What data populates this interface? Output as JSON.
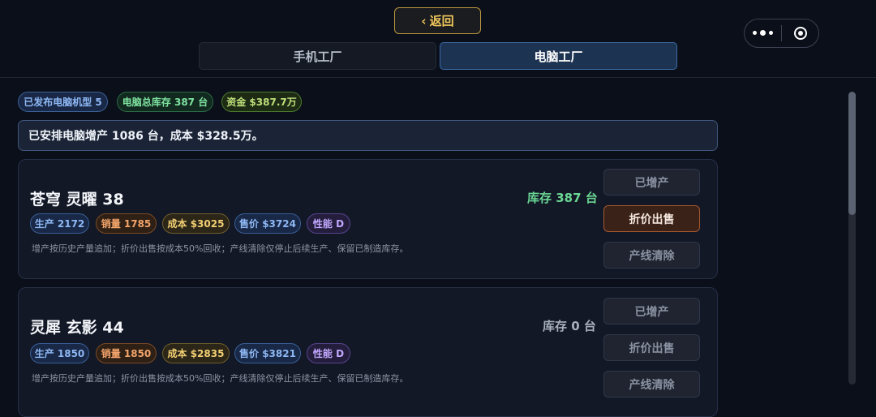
{
  "nav": {
    "back_label": "返回",
    "back_chevron": "‹",
    "capsule": {
      "more_icon": "more-dots-icon",
      "close_icon": "target-close-icon"
    }
  },
  "tabs": [
    {
      "label": "手机工厂",
      "active": false
    },
    {
      "label": "电脑工厂",
      "active": true
    }
  ],
  "summary": {
    "models": "已发布电脑机型 5",
    "inventory": "电脑总库存 387 台",
    "funds": "资金 $387.7万"
  },
  "notice": "已安排电脑增产 1086 台，成本 $328.5万。",
  "products": [
    {
      "name": "苍穹 灵曜 38",
      "stock": "库存 387 台",
      "tags": {
        "production": "生产 2172",
        "sales": "销量 1785",
        "cost": "成本 $3025",
        "price": "售价 $3724",
        "performance": "性能 D"
      },
      "note": "增产按历史产量追加；折价出售按成本50%回收；产线清除仅停止后续生产、保留已制造库存。",
      "actions": {
        "increase": "已增产",
        "discount": "折价出售",
        "clear": "产线清除"
      }
    },
    {
      "name": "灵犀 玄影 44",
      "stock": "库存 0 台",
      "tags": {
        "production": "生产 1850",
        "sales": "销量 1850",
        "cost": "成本 $2835",
        "price": "售价 $3821",
        "performance": "性能 D"
      },
      "note": "增产按历史产量追加；折价出售按成本50%回收；产线清除仅停止后续生产、保留已制造库存。",
      "actions": {
        "increase": "已增产",
        "discount": "折价出售",
        "clear": "产线清除"
      }
    }
  ],
  "colors": {
    "background": "#0b0f19",
    "accent_gold": "#f0c75a",
    "active_tab": "#1c3352",
    "stock_green": "#6ad693",
    "sell_button_border": "#a5582f"
  }
}
